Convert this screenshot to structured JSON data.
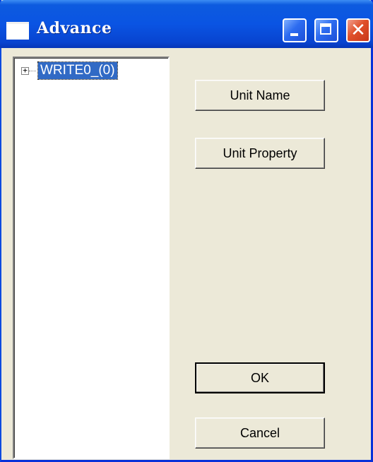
{
  "window": {
    "title": "Advance"
  },
  "tree": {
    "nodes": [
      {
        "label": "WRITE0_(0)",
        "expanded": false,
        "selected": true
      }
    ]
  },
  "buttons": {
    "unit_name": "Unit Name",
    "unit_property": "Unit Property",
    "ok": "OK",
    "cancel": "Cancel"
  },
  "titlebar_buttons": {
    "close_glyph": "✕"
  },
  "icons": {
    "app": "window-icon",
    "minimize": "minimize-icon",
    "maximize": "maximize-icon",
    "close": "close-icon",
    "expand": "plus-expander-icon"
  },
  "colors": {
    "titlebar": "#0a54e3",
    "selection": "#316ac5",
    "dialog_bg": "#ece9d8",
    "close_button": "#e0502a"
  }
}
